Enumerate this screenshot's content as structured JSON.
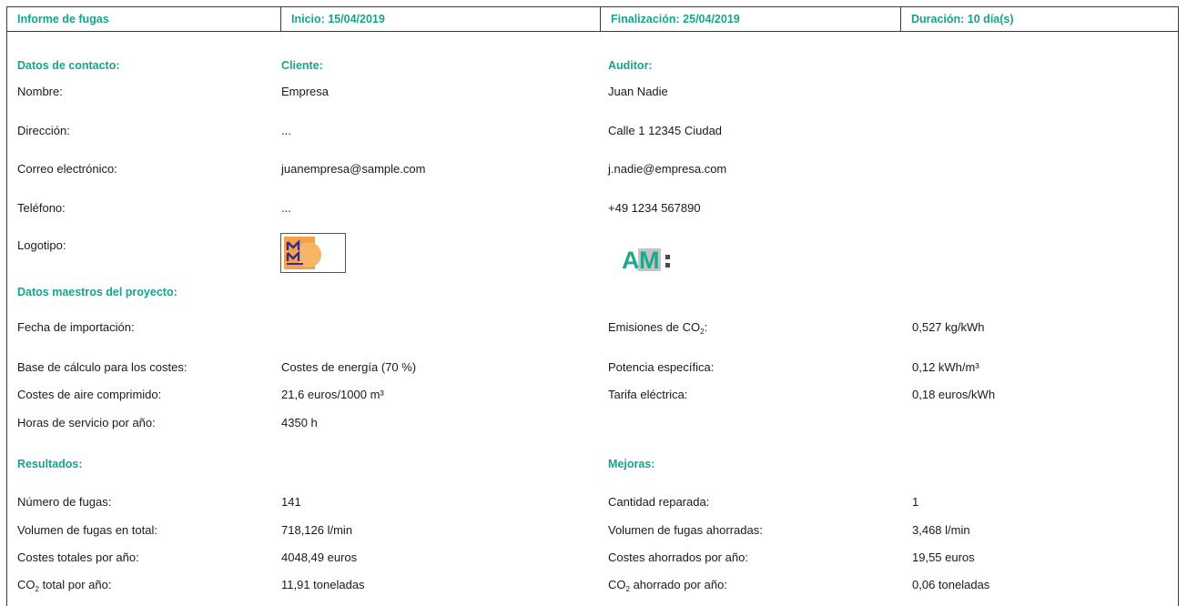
{
  "header": {
    "title": "Informe de fugas",
    "start": "Inicio: 15/04/2019",
    "end": "Finalización: 25/04/2019",
    "duration": "Duración: 10 día(s)"
  },
  "contact": {
    "section_label": "Datos de contacto:",
    "client_label": "Cliente:",
    "auditor_label": "Auditor:",
    "rows": [
      {
        "label": "Nombre:",
        "client": "Empresa",
        "auditor": "Juan Nadie"
      },
      {
        "label": "Dirección:",
        "client": "...",
        "auditor": "Calle 1 12345 Ciudad"
      },
      {
        "label": "Correo electrónico:",
        "client": "juanempresa@sample.com",
        "auditor": "j.nadie@empresa.com"
      },
      {
        "label": "Teléfono:",
        "client": "...",
        "auditor": "+49 1234 567890"
      }
    ],
    "logo_label": "Logotipo:",
    "client_logo": {
      "icon": "client-logo-icon",
      "letters": "M M"
    },
    "auditor_logo": {
      "icon": "auditor-logo-icon",
      "letters": "AM"
    }
  },
  "master": {
    "section_label": "Datos maestros del proyecto:",
    "import_date_label": "Fecha de importación:",
    "import_date_value": "",
    "co2_emissions_label_main": "Emisiones de CO",
    "co2_emissions_label_sub": "2",
    "co2_emissions_label_tail": ":",
    "co2_emissions_value": "0,527 kg/kWh",
    "cost_basis_label": "Base de cálculo para los costes:",
    "cost_basis_value": "Costes de energía (70 %)",
    "specific_power_label": "Potencia específica:",
    "specific_power_value": "0,12 kWh/m³",
    "air_cost_label": "Costes de aire comprimido:",
    "air_cost_value": "21,6 euros/1000 m³",
    "tariff_label": "Tarifa eléctrica:",
    "tariff_value": "0,18 euros/kWh",
    "hours_label": "Horas de servicio por año:",
    "hours_value": "4350 h"
  },
  "results": {
    "section_label": "Resultados:",
    "leaks_label": "Número de fugas:",
    "leaks_value": "141",
    "volume_label": "Volumen de fugas en total:",
    "volume_value": "718,126 l/min",
    "costs_label": "Costes totales por año:",
    "costs_value": "4048,49 euros",
    "co2_label_main": "CO",
    "co2_label_sub": "2",
    "co2_label_tail": " total por año:",
    "co2_value": "11,91 toneladas"
  },
  "improvements": {
    "section_label": "Mejoras:",
    "repaired_label": "Cantidad reparada:",
    "repaired_value": "1",
    "saved_volume_label": "Volumen de fugas ahorradas:",
    "saved_volume_value": "3,468 l/min",
    "saved_costs_label": "Costes ahorrados por año:",
    "saved_costs_value": "19,55 euros",
    "saved_co2_label_main": "CO",
    "saved_co2_label_sub": "2",
    "saved_co2_label_tail": " ahorrado por año:",
    "saved_co2_value": "0,06 toneladas"
  },
  "colors": {
    "accent": "#18a38c",
    "border": "#3a3a3a",
    "text": "#1a1a1a"
  }
}
